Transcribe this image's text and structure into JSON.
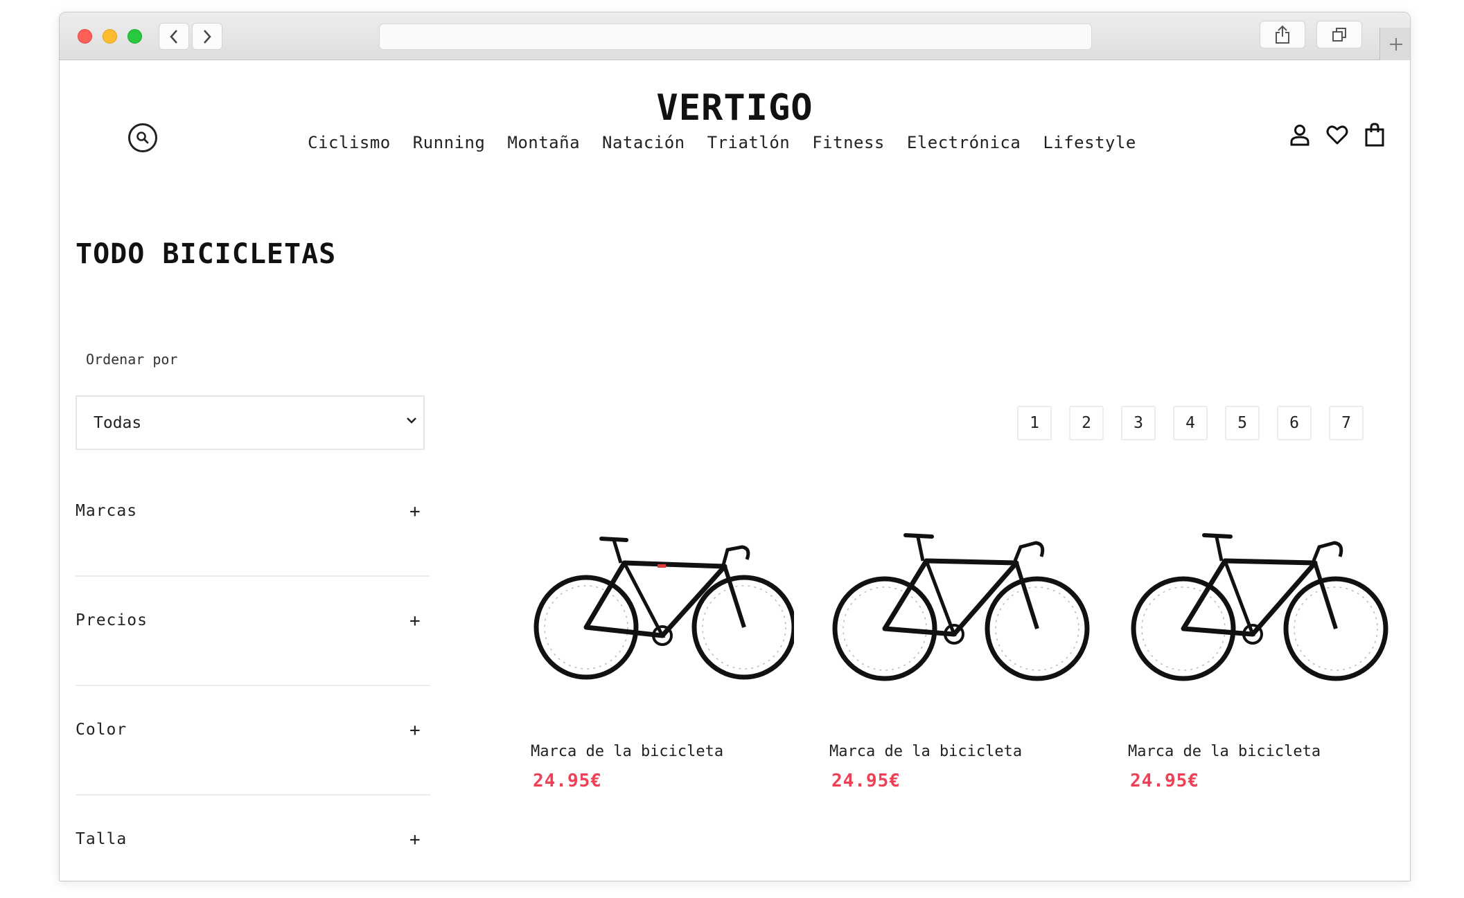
{
  "brand": {
    "logo": "VERTIGO",
    "accent_color": "#ef4056"
  },
  "browser": {
    "url": "",
    "buttons": {
      "back_icon": "chevron-left-icon",
      "forward_icon": "chevron-right-icon",
      "share_icon": "share-icon",
      "tabs_icon": "tabs-icon",
      "new_tab_icon": "plus-icon"
    }
  },
  "header": {
    "nav": [
      "Ciclismo",
      "Running",
      "Montaña",
      "Natación",
      "Triatlón",
      "Fitness",
      "Electrónica",
      "Lifestyle"
    ],
    "icons": [
      "search-icon",
      "user-icon",
      "heart-icon",
      "bag-icon"
    ]
  },
  "main": {
    "title": "TODO BICICLETAS",
    "sort_label": "Ordenar por",
    "sort_value": "Todas",
    "filters": [
      {
        "label": "Marcas",
        "toggle": "+"
      },
      {
        "label": "Precios",
        "toggle": "+"
      },
      {
        "label": "Color",
        "toggle": "+"
      },
      {
        "label": "Talla",
        "toggle": "+"
      }
    ],
    "pagination": [
      "1",
      "2",
      "3",
      "4",
      "5",
      "6",
      "7"
    ],
    "products": [
      {
        "name": "Marca de la bicicleta",
        "price": "24.95€",
        "image": "road-bike-image"
      },
      {
        "name": "Marca de la bicicleta",
        "price": "24.95€",
        "image": "road-bike-image"
      },
      {
        "name": "Marca de la bicicleta",
        "price": "24.95€",
        "image": "road-bike-image"
      }
    ]
  }
}
